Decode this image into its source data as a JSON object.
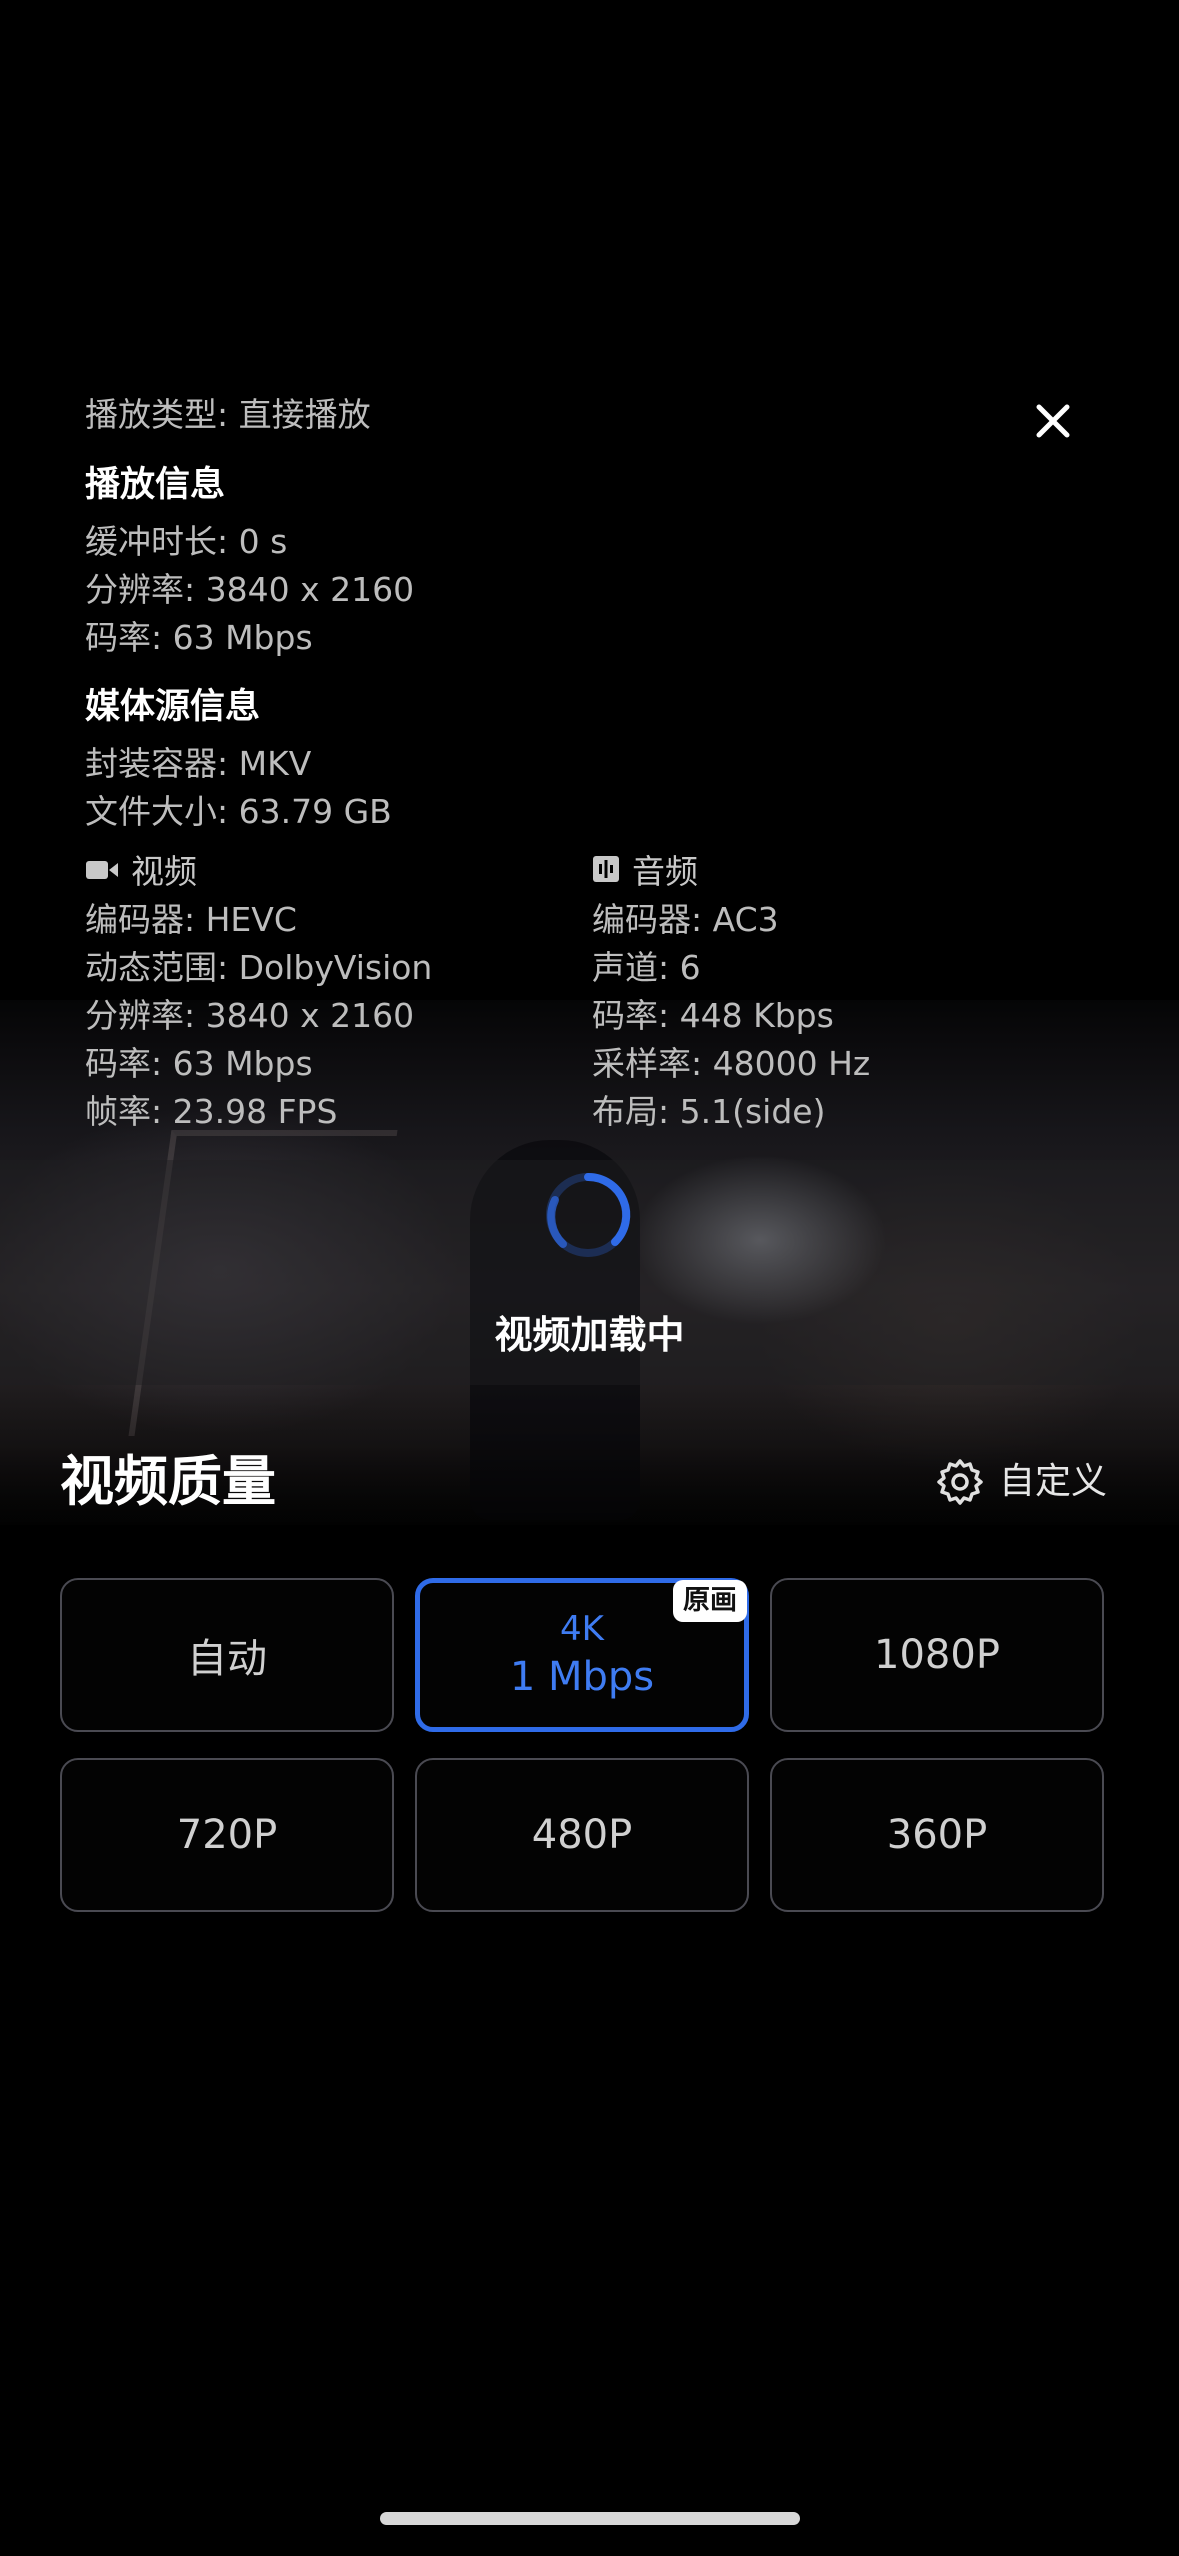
{
  "playback_type": "播放类型: 直接播放",
  "playback_info": {
    "title": "播放信息",
    "buffer": "缓冲时长: 0 s",
    "resolution": "分辨率: 3840 x 2160",
    "bitrate": "码率: 63 Mbps"
  },
  "media_source": {
    "title": "媒体源信息",
    "container": "封装容器: MKV",
    "file_size": "文件大小: 63.79 GB"
  },
  "video": {
    "title": "视频",
    "icon": "video-camera-icon",
    "codec": "编码器: HEVC",
    "dynamic_range": "动态范围: DolbyVision",
    "resolution": "分辨率: 3840 x 2160",
    "bitrate": "码率: 63 Mbps",
    "frame_rate": "帧率: 23.98 FPS"
  },
  "audio": {
    "title": "音频",
    "icon": "audio-waveform-icon",
    "codec": "编码器: AC3",
    "channels": "声道:  6",
    "bitrate": "码率: 448 Kbps",
    "sample_rate": "采样率: 48000 Hz",
    "layout": "布局: 5.1(side)"
  },
  "loading": {
    "text": "视频加载中"
  },
  "quality": {
    "title": "视频质量",
    "custom_label": "自定义",
    "options": [
      {
        "label": "自动"
      },
      {
        "label_line1": "4K",
        "label_line2": "1 Mbps",
        "badge": "原画",
        "selected": true
      },
      {
        "label": "1080P"
      },
      {
        "label": "720P"
      },
      {
        "label": "480P"
      },
      {
        "label": "360P"
      }
    ]
  },
  "colors": {
    "accent": "#2f6be8",
    "background": "#000000",
    "button_border": "#4a4a52"
  }
}
